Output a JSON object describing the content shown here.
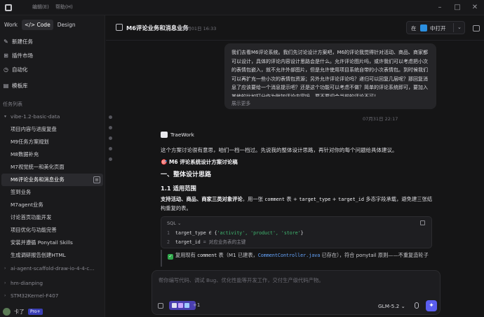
{
  "topbar": {
    "menu": [
      "编辑(E)",
      "帮助(H)"
    ],
    "window_controls": [
      "minimize-icon",
      "maximize-icon",
      "close-icon"
    ]
  },
  "sidebar": {
    "modes": [
      "Work",
      "Code",
      "Design"
    ],
    "active_mode": "Code",
    "actions": [
      {
        "label": "新建任务",
        "icon": "new-task-icon"
      },
      {
        "label": "插件市场",
        "icon": "plugin-icon"
      },
      {
        "label": "自动化",
        "icon": "automation-icon"
      },
      {
        "label": "模板库",
        "icon": "template-icon"
      }
    ],
    "task_list_title": "任务列表",
    "tree": [
      {
        "label": "vibe-1.2-basic-data",
        "group": true
      },
      {
        "label": "项目内容与进度复盘"
      },
      {
        "label": "M9任务方案规划"
      },
      {
        "label": "M8数据补充"
      },
      {
        "label": "M7视觉统一和美化页面"
      },
      {
        "label": "M6评论业务和消息业务",
        "active": true
      },
      {
        "label": "签到业务"
      },
      {
        "label": "M7agent业务"
      },
      {
        "label": "讨论首页功能开发"
      },
      {
        "label": "项目优化与功能完善"
      },
      {
        "label": "安装并遵循 Ponytail Skills"
      },
      {
        "label": "生成调研报告创建HTML"
      },
      {
        "label": "ai-agent-scaffold-draw-io-4-4-c...",
        "group": true
      },
      {
        "label": "hm-dianping",
        "group": true
      },
      {
        "label": "STM32Kernel-F407",
        "group": true
      }
    ],
    "user": {
      "name": "卡了",
      "badge": "Pro+"
    }
  },
  "header": {
    "title": "M6评论业务和消息业务",
    "time": "08月01日 16:33",
    "open_prefix": "在",
    "open_label": "中打开"
  },
  "user_message": {
    "text": "我们去看M6评论系统。我们先讨论设计方案吧，M6的评论我觉得针对活动、商品、商家都可以设计，具体的评论内容设计思路会是什么。允许评论图片吗，或许我们可以考虑把小次的表情包嵌入，就不允许外部图片，但是允许使用项目系统自带的小次表情包。到时候我们可以再扩充一些小次的表情包资源；另外允许评论评论吗？递归可以回复几层呢？那回复消息了应该要给一个消息提示吧？还是这个功能可以考虑不做？简单的评论系统即可，要加入其他的比如打分作为附加评论内容吗，要不要迎合当前的评论不可！",
    "more": "展示更多",
    "time": "07月31日 22:17"
  },
  "assistant": {
    "brand": "TraeWork",
    "intro": "这个方案讨论很有意思，咱们一档一档过。先说我的整体设计思路，再针对你的每个问题给具体建议。",
    "doc_title": "🎯 M6 评论系统设计方案讨论稿",
    "h2": "一、整体设计思路",
    "h3": "1.1 适用范围",
    "para_bold": "支持活动、商品、商家三类对象评论",
    "para_mid": "，用一张",
    "para_code1": "comment",
    "para_mid2": "表 +",
    "para_code2": "target_type",
    "para_mid3": "+",
    "para_code3": "target_id",
    "para_tail": "多态字段承载，避免建三张结构重复的表。",
    "code": {
      "lang": "SQL",
      "lines": [
        {
          "n": "1",
          "kw": "target_type ∈ {",
          "str": "'activity', 'product', 'store'",
          "end": "}",
          "cm": ""
        },
        {
          "n": "2",
          "kw": "target_id    ",
          "str": "",
          "end": "",
          "cm": "= 对应业务表的主键"
        }
      ]
    },
    "check": {
      "pre": "复用现有",
      "code1": "comment",
      "mid": "表（M1 已建表，",
      "code2": "CommentController.java",
      "tail": "已存在），符合 ponytail 原则——不重复造轮子"
    }
  },
  "composer": {
    "placeholder": "帮你编写代码、调试 Bug、优化性能等开发工作，交付生产级代码产物。",
    "plus_count": "+1",
    "model": "GLM-5.2 ⌄"
  }
}
